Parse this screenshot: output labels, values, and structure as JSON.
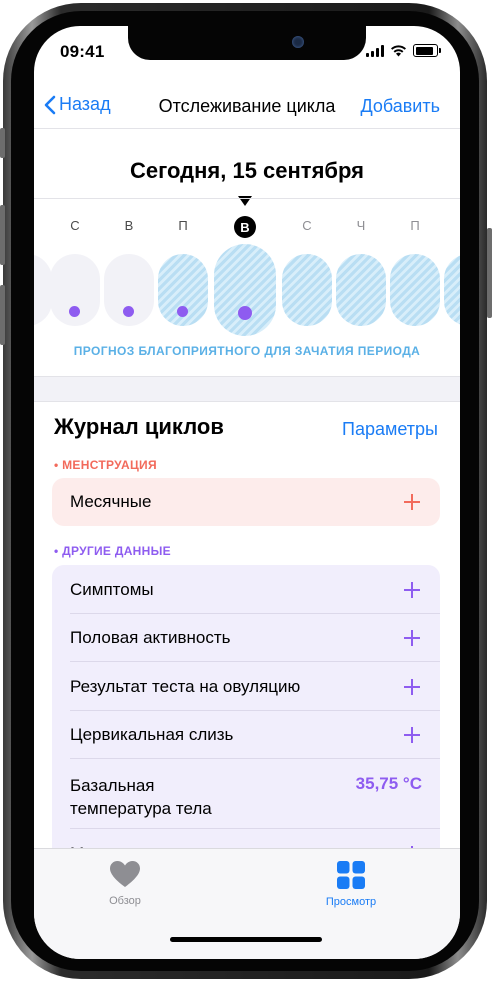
{
  "status_bar": {
    "time": "09:41"
  },
  "nav": {
    "back_label": "Назад",
    "title": "Отслеживание цикла",
    "add_label": "Добавить"
  },
  "calendar": {
    "today_label": "Сегодня, 15 сентября",
    "days": [
      "С",
      "В",
      "П",
      "В",
      "С",
      "Ч",
      "П"
    ],
    "forecast_label": "ПРОГНОЗ БЛАГОПРИЯТНОГО ДЛЯ ЗАЧАТИЯ ПЕРИОДА"
  },
  "cycle_log": {
    "title": "Журнал циклов",
    "params_label": "Параметры",
    "menstruation": {
      "section_label": "• МЕНСТРУАЦИЯ",
      "item": "Месячные"
    },
    "other": {
      "section_label": "• ДРУГИЕ ДАННЫЕ",
      "items": [
        "Симптомы",
        "Половая активность",
        "Результат теста на овуляцию",
        "Цервикальная слизь"
      ],
      "basal_temp": {
        "label_line1": "Базальная",
        "label_line2": "температура тела",
        "value": "35,75 °C"
      },
      "partial_item": "Мажущие"
    }
  },
  "tabbar": {
    "tabs": [
      {
        "label": "Обзор"
      },
      {
        "label": "Просмотр"
      }
    ]
  },
  "colors": {
    "accent_blue": "#1a7cf5",
    "purple": "#8e5cf0",
    "red": "#f26a5b",
    "forecast_blue": "#5ab0e6"
  },
  "icons": [
    "chevron-left-icon",
    "signal-icon",
    "wifi-icon",
    "battery-icon",
    "plus-icon",
    "heart-icon",
    "grid-icon"
  ]
}
